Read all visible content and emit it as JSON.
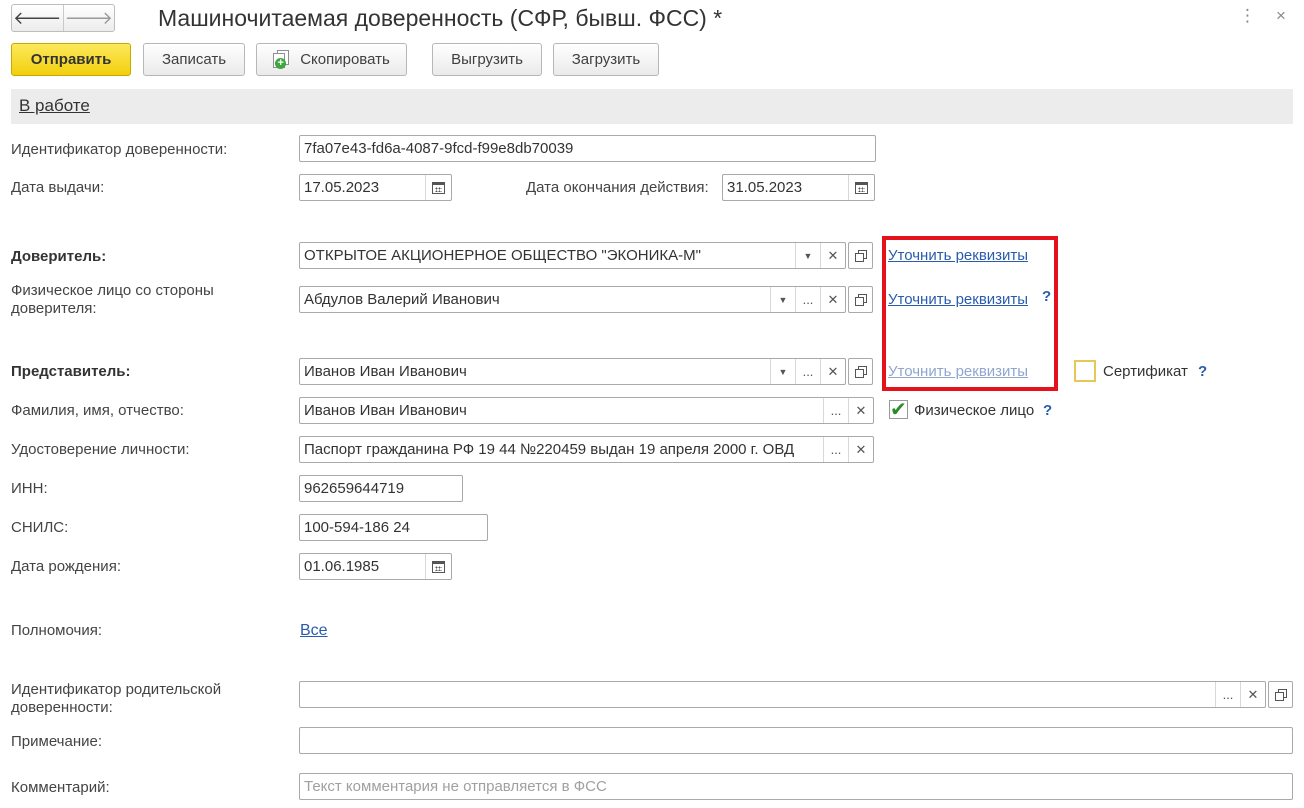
{
  "window": {
    "title": "Машиночитаемая доверенность (СФР, бывш. ФСС) *",
    "menu_glyph": "⋮",
    "close_glyph": "×"
  },
  "nav": {
    "back_glyph": "🡐",
    "forward_glyph": "🡒"
  },
  "toolbar": {
    "send": "Отправить",
    "save": "Записать",
    "copy": "Скопировать",
    "export": "Выгрузить",
    "import": "Загрузить"
  },
  "status": "В работе",
  "form": {
    "id": {
      "label": "Идентификатор доверенности:",
      "value": "7fa07e43-fd6a-4087-9fcd-f99e8db70039"
    },
    "issue_date": {
      "label": "Дата выдачи:",
      "value": "17.05.2023"
    },
    "end_date": {
      "label": "Дата окончания действия:",
      "value": "31.05.2023"
    },
    "principal": {
      "label": "Доверитель:",
      "value": "ОТКРЫТОЕ АКЦИОНЕРНОЕ ОБЩЕСТВО \"ЭКОНИКА-М\""
    },
    "principal_person": {
      "label_line1": "Физическое лицо со стороны",
      "label_line2": "доверителя:",
      "value": "Абдулов Валерий Иванович"
    },
    "representative": {
      "label": "Представитель:",
      "value": "Иванов Иван Иванович"
    },
    "fio": {
      "label": "Фамилия, имя, отчество:",
      "value": "Иванов Иван Иванович"
    },
    "identity_doc": {
      "label": "Удостоверение личности:",
      "value": "Паспорт гражданина РФ 19 44 №220459 выдан 19 апреля 2000 г. ОВД"
    },
    "inn": {
      "label": "ИНН:",
      "value": "962659644719"
    },
    "snils": {
      "label": "СНИЛС:",
      "value": "100-594-186 24"
    },
    "birth_date": {
      "label": "Дата рождения:",
      "value": "01.06.1985"
    },
    "powers": {
      "label": "Полномочия:",
      "link": "Все"
    },
    "parent_id": {
      "label_line1": "Идентификатор родительской",
      "label_line2": "доверенности:",
      "value": ""
    },
    "note": {
      "label": "Примечание:",
      "value": ""
    },
    "comment": {
      "label": "Комментарий:",
      "placeholder": "Текст комментария не отправляется в ФСС"
    }
  },
  "links": {
    "clarify1": "Уточнить реквизиты",
    "clarify2": "Уточнить реквизиты",
    "clarify3": "Уточнить реквизиты"
  },
  "checkboxes": {
    "certificate": {
      "label": "Сертификат",
      "checked": false
    },
    "individual": {
      "label": "Физическое лицо",
      "checked": true
    }
  },
  "glyphs": {
    "help": "?",
    "dropdown": "▼",
    "ellipsis": "...",
    "clear": "✕",
    "check": "✔"
  },
  "colors": {
    "primary_button": "#f2cf0d",
    "highlight_box": "#e5121b",
    "link": "#2a5cad"
  }
}
